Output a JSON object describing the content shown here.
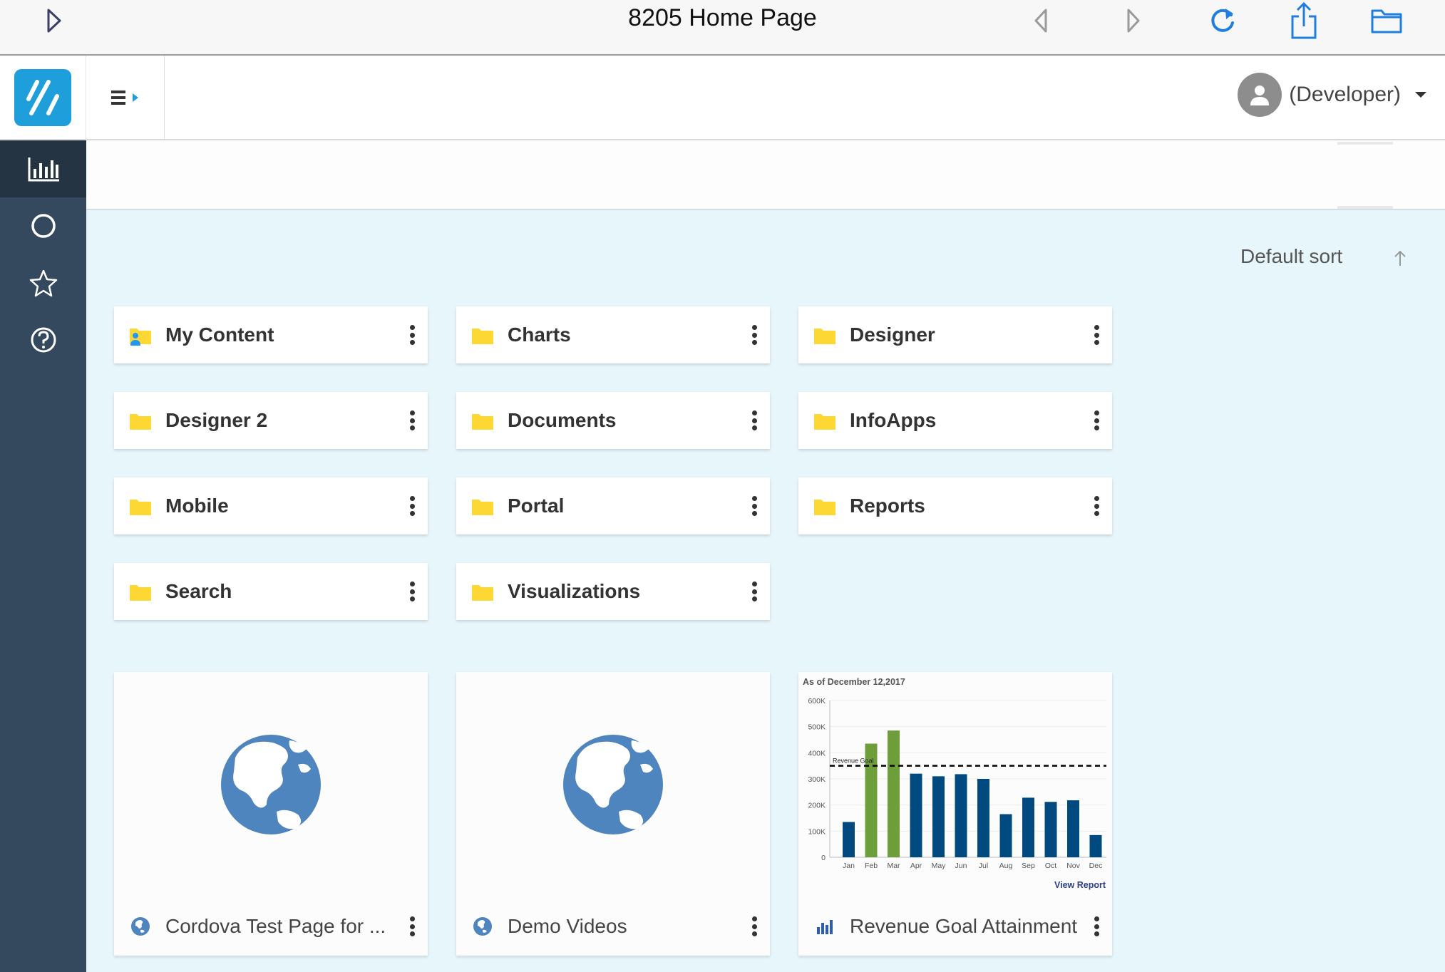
{
  "top_bar": {
    "title": "8205 Home Page",
    "icons": [
      "sidebar-toggle-icon",
      "back-icon",
      "forward-icon",
      "refresh-icon",
      "share-icon",
      "folder-icon"
    ]
  },
  "header": {
    "menu_icon": "hamburger-menu-icon",
    "user_label": "(Developer)"
  },
  "nav": {
    "items": [
      {
        "icon": "bar-chart-icon",
        "active": true
      },
      {
        "icon": "circle-icon",
        "active": false
      },
      {
        "icon": "star-icon",
        "active": false
      },
      {
        "icon": "help-icon",
        "active": false
      }
    ]
  },
  "sort": {
    "label": "Default sort"
  },
  "folders": [
    {
      "label": "My Content",
      "icon": "user-folder-icon"
    },
    {
      "label": "Charts",
      "icon": "folder-icon"
    },
    {
      "label": "Designer",
      "icon": "folder-icon"
    },
    {
      "label": "Designer 2",
      "icon": "folder-icon"
    },
    {
      "label": "Documents",
      "icon": "folder-icon"
    },
    {
      "label": "InfoApps",
      "icon": "folder-icon"
    },
    {
      "label": "Mobile",
      "icon": "folder-icon"
    },
    {
      "label": "Portal",
      "icon": "folder-icon"
    },
    {
      "label": "Reports",
      "icon": "folder-icon"
    },
    {
      "label": "Search",
      "icon": "folder-icon"
    },
    {
      "label": "Visualizations",
      "icon": "folder-icon"
    }
  ],
  "cards": [
    {
      "label": "Cordova Test Page for ...",
      "icon": "globe-icon"
    },
    {
      "label": "Demo Videos",
      "icon": "globe-icon"
    },
    {
      "label": "Revenue Goal Attainment",
      "icon": "bar-chart-icon"
    }
  ],
  "colors": {
    "accent": "#1e9fdc",
    "nav_bg": "#34495e",
    "folder": "#fdd835",
    "bar_blue": "#004a80",
    "bar_green": "#6e9e3a",
    "globe": "#4f85bf"
  },
  "chart_data": {
    "type": "bar",
    "subtitle": "As of December 12,2017",
    "categories": [
      "Jan",
      "Feb",
      "Mar",
      "Apr",
      "May",
      "Jun",
      "Jul",
      "Aug",
      "Sep",
      "Oct",
      "Nov",
      "Dec"
    ],
    "values": [
      135000,
      435000,
      485000,
      320000,
      310000,
      318000,
      300000,
      165000,
      228000,
      212000,
      218000,
      85000
    ],
    "highlight": [
      "Feb",
      "Mar"
    ],
    "yticks": [
      "0",
      "100K",
      "200K",
      "300K",
      "400K",
      "500K",
      "600K"
    ],
    "ylim": [
      0,
      600000
    ],
    "goal_label": "Revenue Goal",
    "goal_value": 350000,
    "link": "View Report"
  }
}
